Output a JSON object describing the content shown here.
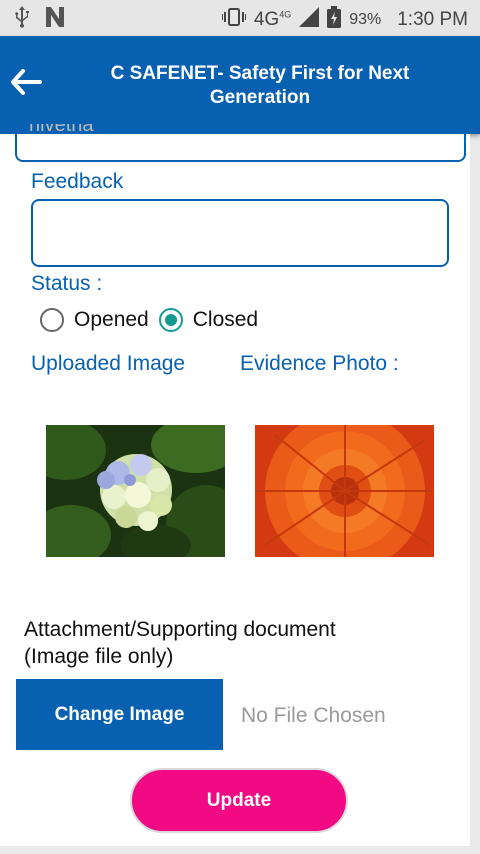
{
  "status_bar": {
    "network": "4G",
    "network_small": "4G",
    "battery": "93%",
    "time": "1:30 PM",
    "icons": [
      "usb-icon",
      "n-icon",
      "vibrate-icon",
      "signal-icon",
      "battery-icon"
    ]
  },
  "app_bar": {
    "title": "C SAFENET- Safety First for Next Generation"
  },
  "form": {
    "top_input_value": "nivetha",
    "feedback_label": "Feedback",
    "feedback_value": "",
    "status_label": "Status :",
    "status_options": [
      {
        "label": "Opened",
        "selected": false
      },
      {
        "label": "Closed",
        "selected": true
      }
    ],
    "uploaded_image_label": "Uploaded Image",
    "evidence_photo_label": "Evidence Photo :",
    "attachment_label": "Attachment/Supporting document (Image file only)",
    "change_image_button": "Change Image",
    "file_status": "No File Chosen",
    "update_button": "Update"
  },
  "colors": {
    "primary": "#0861b0",
    "accent": "#f20a84",
    "radio": "#149b8f"
  }
}
